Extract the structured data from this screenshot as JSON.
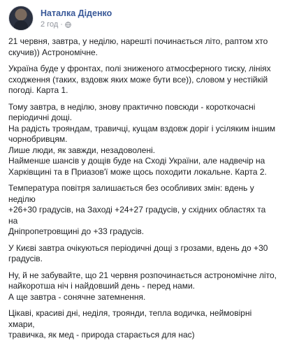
{
  "post": {
    "author": "Наталка Діденко",
    "time": "2 год",
    "separator": "·",
    "paragraphs": [
      [
        "21 червня, завтра, у неділю, нарешті починається літо, раптом хто",
        "скучив)) Астрономічне."
      ],
      [
        "Україна буде у фронтах, полі зниженого атмосферного тиску, лініях",
        "сходження (таких, вздовж яких може бути все)), словом у нестійкій",
        "погоді. Карта 1."
      ],
      [
        "Тому завтра, в неділю, знову практично повсюди - короткочасні",
        "періодичні дощі.",
        "На радість трояндам, травичці, кущам вздовж доріг і усіляким іншим",
        "чорнобривцям.",
        "Лише люди, як завжди, незадоволені.",
        "Найменше шансів у дощів буде на Сході України, але надвечір на",
        "Харківщині та в Приазов'ї може щось походити локальне. Карта 2."
      ],
      [
        "Температура повітря залишається без особливих змін: вдень у неділю",
        "+26+30 градусів, на Заході +24+27 градусів, у східних областях та на",
        "Дніпропетровщині до +33 градусів."
      ],
      [
        "У Києві завтра очікуються періодичні дощі з грозами, вдень до +30",
        "градусів."
      ],
      [
        "Ну, й не забувайте, що 21 червня розпочинається астрономічне літо,",
        "найкоротша ніч і найдовший день - перед нами.",
        "А ще завтра - сонячне затемнення."
      ],
      [
        "Цікаві, красиві дні, неділя, троянди, тепла водичка, неймовірні хмари,",
        "травичка, як мед - природа старається для нас)"
      ]
    ]
  }
}
